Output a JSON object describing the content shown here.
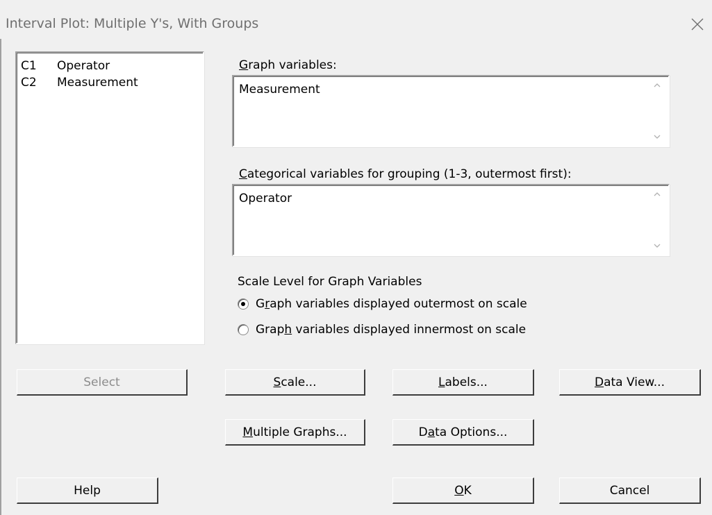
{
  "window": {
    "title": "Interval Plot: Multiple Y's, With Groups"
  },
  "variables": [
    {
      "id": "C1",
      "name": "Operator"
    },
    {
      "id": "C2",
      "name": "Measurement"
    }
  ],
  "graph_variables": {
    "label_prefix": "G",
    "label_rest": "raph variables:",
    "value": "Measurement"
  },
  "categorical": {
    "label_prefix": "C",
    "label_rest": "ategorical variables for grouping (1-3, outermost first):",
    "value": "Operator"
  },
  "scale_level": {
    "label": "Scale Level for Graph Variables",
    "options": [
      {
        "pre": "G",
        "key": "r",
        "post": "aph variables displayed outermost on scale",
        "checked": true
      },
      {
        "pre": "Grap",
        "key": "h",
        "post": " variables displayed innermost on scale",
        "checked": false
      }
    ]
  },
  "buttons": {
    "select": "Select",
    "scale": {
      "key": "S",
      "rest": "cale..."
    },
    "labels": {
      "key": "L",
      "rest": "abels..."
    },
    "data_view": {
      "key": "D",
      "rest": "ata View..."
    },
    "multiple_graphs": {
      "key": "M",
      "rest": "ultiple Graphs..."
    },
    "data_options": {
      "pre": "D",
      "key": "a",
      "rest": "ta Options..."
    },
    "help": "Help",
    "ok": {
      "key": "O",
      "rest": "K"
    },
    "cancel": "Cancel"
  }
}
